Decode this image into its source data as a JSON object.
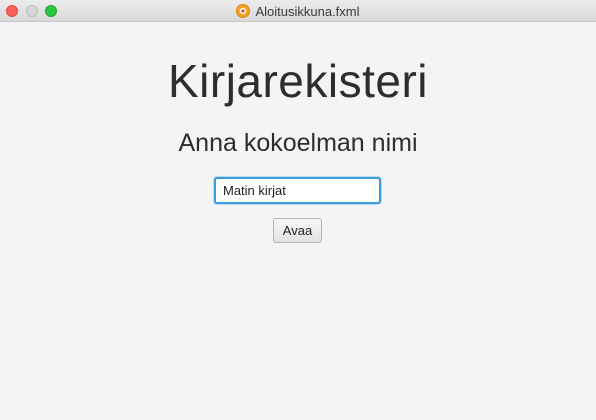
{
  "window": {
    "title": "Aloitusikkuna.fxml",
    "title_icon": "app-icon",
    "controls": [
      "close",
      "minimize",
      "maximize"
    ]
  },
  "main": {
    "heading": "Kirjarekisteri",
    "subheading": "Anna kokoelman nimi",
    "name_input": {
      "value": "Matin kirjat",
      "placeholder": ""
    },
    "open_button_label": "Avaa"
  },
  "colors": {
    "accent": "#3c9cdb",
    "background": "#f4f4f4",
    "text": "#2d2d2d"
  }
}
